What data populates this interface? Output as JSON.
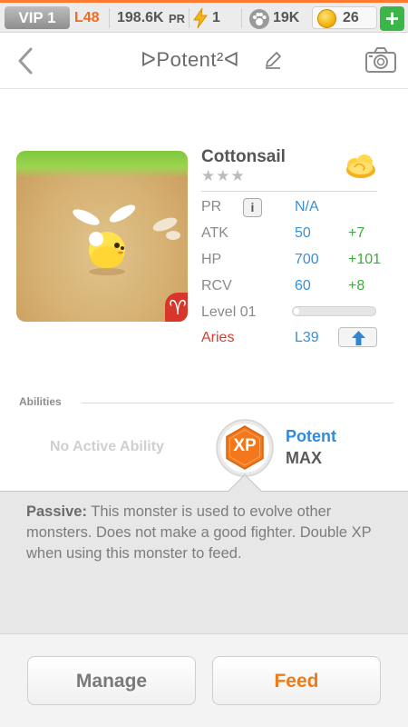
{
  "status_bar": {
    "vip": "VIP 1",
    "level": "L48",
    "pr_value": "198.6K",
    "pr_unit": "PR",
    "energy": "1",
    "paws": "19K",
    "coins": "26",
    "plus": "+"
  },
  "header": {
    "title": "ᐅPotent²ᐊ",
    "icons": [
      "back-chevron-icon",
      "pencil-icon",
      "camera-icon"
    ]
  },
  "monster": {
    "name": "Cottonsail",
    "stars_filled": 0,
    "stars_total": 3,
    "star_glyphs": "★★★",
    "element_icon": "cloud-icon",
    "stats": {
      "pr_label": "PR",
      "info_label": "i",
      "pr_value": "N/A",
      "atk_label": "ATK",
      "atk_value": "50",
      "atk_bonus": "+7",
      "hp_label": "HP",
      "hp_value": "700",
      "hp_bonus": "+101",
      "rcv_label": "RCV",
      "rcv_value": "60",
      "rcv_bonus": "+8",
      "level_label": "Level 01",
      "xp_progress": 0.0
    },
    "zodiac": {
      "sign": "Aries",
      "glyph": "♈",
      "level": "L39",
      "action_icon": "up-arrow-icon"
    }
  },
  "abilities": {
    "section_title": "Abilities",
    "active": "No Active Ability",
    "passive_badge": "XP",
    "passive_name": "Potent",
    "passive_level": "MAX",
    "passive_label": "Passive:",
    "passive_text": " This monster is used to evolve other monsters. Does not make a good fighter. Double XP when using this monster to feed."
  },
  "actions": {
    "manage": "Manage",
    "feed": "Feed"
  },
  "colors": {
    "accent_orange": "#f07a18",
    "link_blue": "#3a8fd6",
    "bonus_green": "#3aad3a",
    "zodiac_red": "#d63f2f"
  }
}
